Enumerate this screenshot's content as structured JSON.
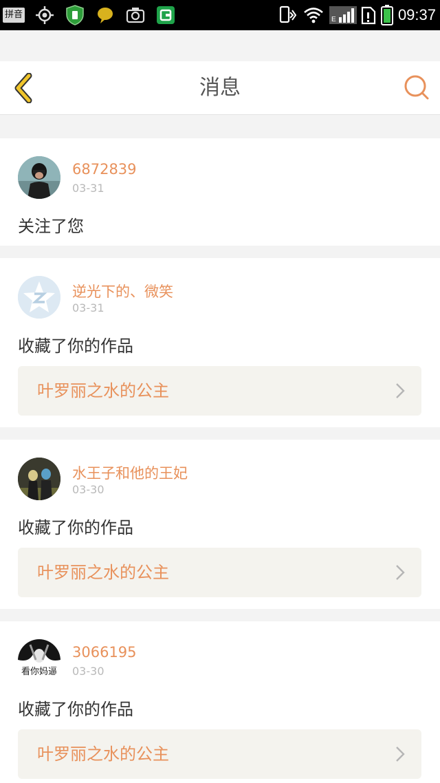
{
  "status_bar": {
    "ime_label": "拼音",
    "time": "09:37",
    "icons": [
      "gps-icon",
      "shield-icon",
      "chat-bubble-icon",
      "screenshot-icon",
      "app-badge-icon",
      "phone-vibrate-icon",
      "wifi-icon",
      "signal-icon",
      "sim-alert-icon",
      "battery-icon"
    ],
    "network_label": "E"
  },
  "header": {
    "title": "消息",
    "back_icon": "back-chevron-icon",
    "search_icon": "search-icon",
    "accent_color": "#e8915b",
    "back_color": "#f0c52b"
  },
  "messages": [
    {
      "username": "6872839",
      "date": "03-31",
      "action": "关注了您"
    },
    {
      "username": "逆光下的、微笑",
      "date": "03-31",
      "action": "收藏了你的作品",
      "work_title": "叶罗丽之水的公主"
    },
    {
      "username": "水王子和他的王妃",
      "date": "03-30",
      "action": "收藏了你的作品",
      "work_title": "叶罗丽之水的公主"
    },
    {
      "username": "3066195",
      "date": "03-30",
      "action": "收藏了你的作品",
      "work_title": "叶罗丽之水的公主",
      "avatar_text": "看你妈逼"
    }
  ]
}
